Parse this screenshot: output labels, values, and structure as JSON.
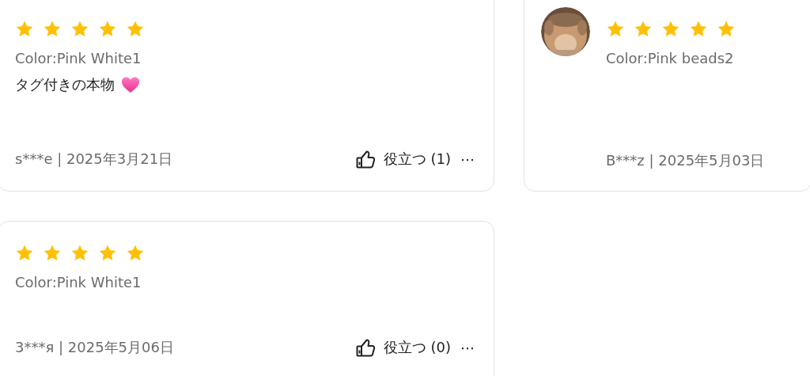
{
  "reviews": [
    {
      "stars": 5,
      "option": "Color:Pink White1",
      "text": "タグ付きの本物",
      "heart": true,
      "author_date": "s***e | 2025年3月21日",
      "helpful": "役立つ (1)",
      "more": "⋯"
    },
    {
      "stars": 5,
      "option": "Color:Pink beads2",
      "author_date": "B***z | 2025年5月03日"
    },
    {
      "stars": 5,
      "option": "Color:Pink White1",
      "author_date": "3***я | 2025年5月06日",
      "helpful": "役立つ (0)",
      "more": "⋯"
    }
  ]
}
